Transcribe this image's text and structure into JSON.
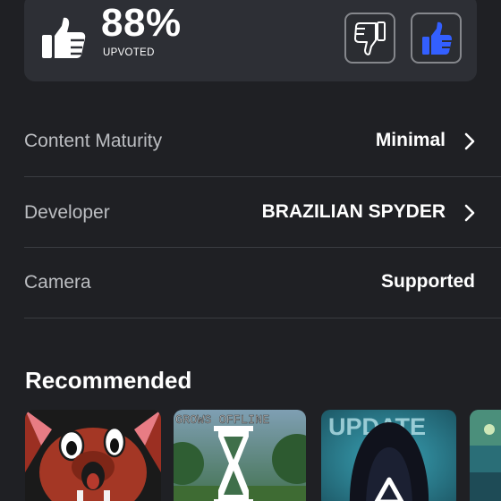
{
  "vote": {
    "percent": "88%",
    "caption": "UPVOTED",
    "user_vote": "up"
  },
  "icons": {
    "thumb_summary": "thumbs-up-icon",
    "thumbs_down": "thumbs-down-icon",
    "thumbs_up": "thumbs-up-icon",
    "chevron": "chevron-right-icon"
  },
  "colors": {
    "background": "#1f2024",
    "card": "#2d2f35",
    "accent_blue": "#335fff",
    "label_text": "#bcbec2",
    "divider": "#3a3c41"
  },
  "info": {
    "rows": [
      {
        "label": "Content Maturity",
        "value": "Minimal",
        "navigable": true
      },
      {
        "label": "Developer",
        "value": "BRAZILIAN SPYDER",
        "navigable": true
      },
      {
        "label": "Camera",
        "value": "Supported",
        "navigable": false
      }
    ]
  },
  "recommended": {
    "title": "Recommended",
    "tiles": [
      {
        "name": "game-thumbnail-fox"
      },
      {
        "name": "game-thumbnail-grow",
        "banner": "GROWS OFFLINE"
      },
      {
        "name": "game-thumbnail-update",
        "banner": "UPDATE"
      },
      {
        "name": "game-thumbnail-partial"
      }
    ]
  }
}
